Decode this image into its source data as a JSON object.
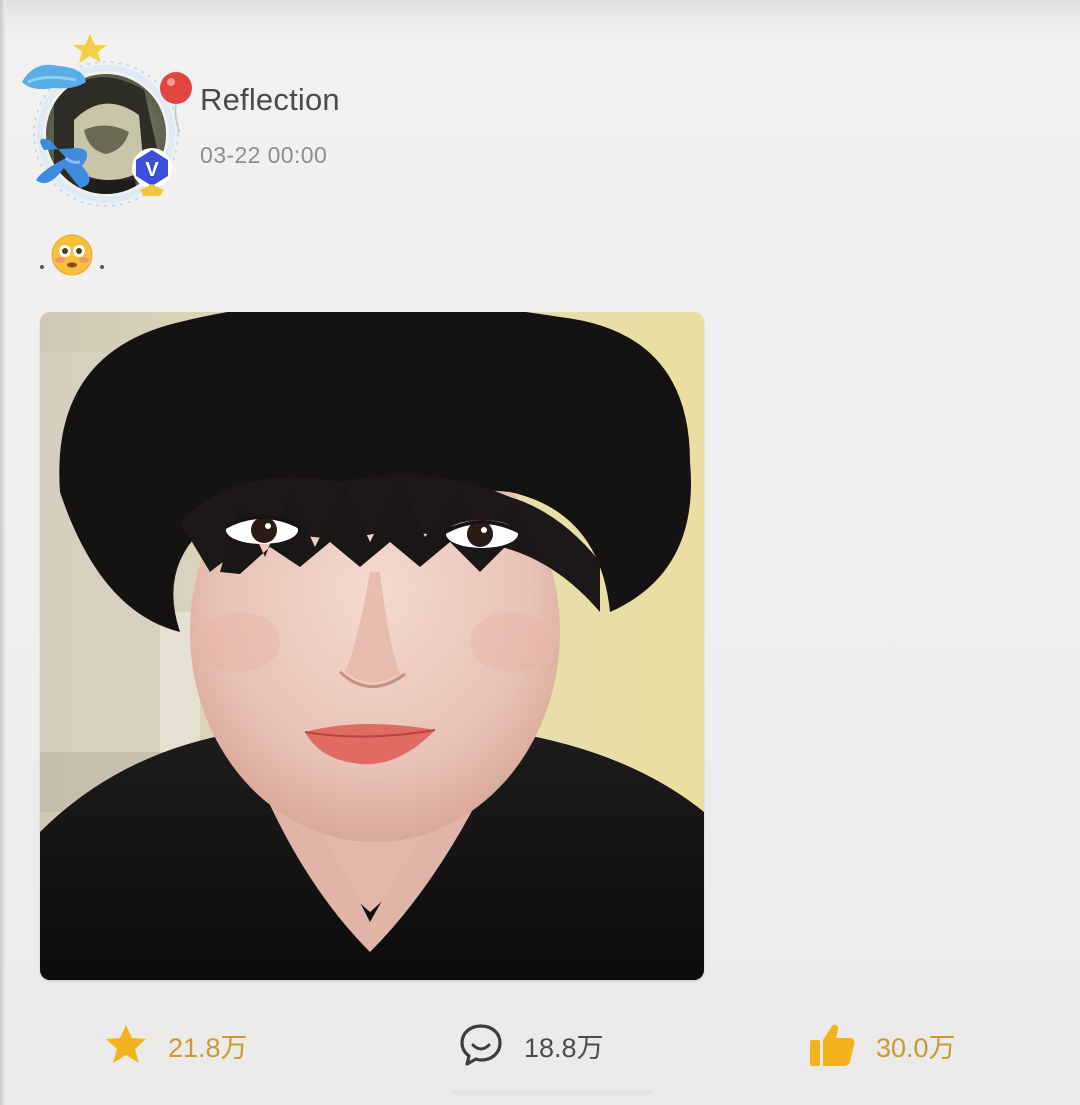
{
  "post": {
    "author": {
      "name": "Reflection",
      "verified_badge": "V"
    },
    "timestamp": "03-22 00:00",
    "text_emoji": "😳",
    "photo_icon": "selfie-photo"
  },
  "actions": {
    "favorite": {
      "icon": "star-icon",
      "count": "21.8万"
    },
    "comment": {
      "icon": "comment-icon",
      "count": "18.8万"
    },
    "like": {
      "icon": "thumbs-up-icon",
      "count": "30.0万"
    }
  },
  "colors": {
    "accent_gold": "#f2b31d",
    "count_gold": "#c99a33",
    "verified_blue": "#3b4fd8",
    "username": "#4a4a4a",
    "timestamp": "#8d8d8d"
  }
}
